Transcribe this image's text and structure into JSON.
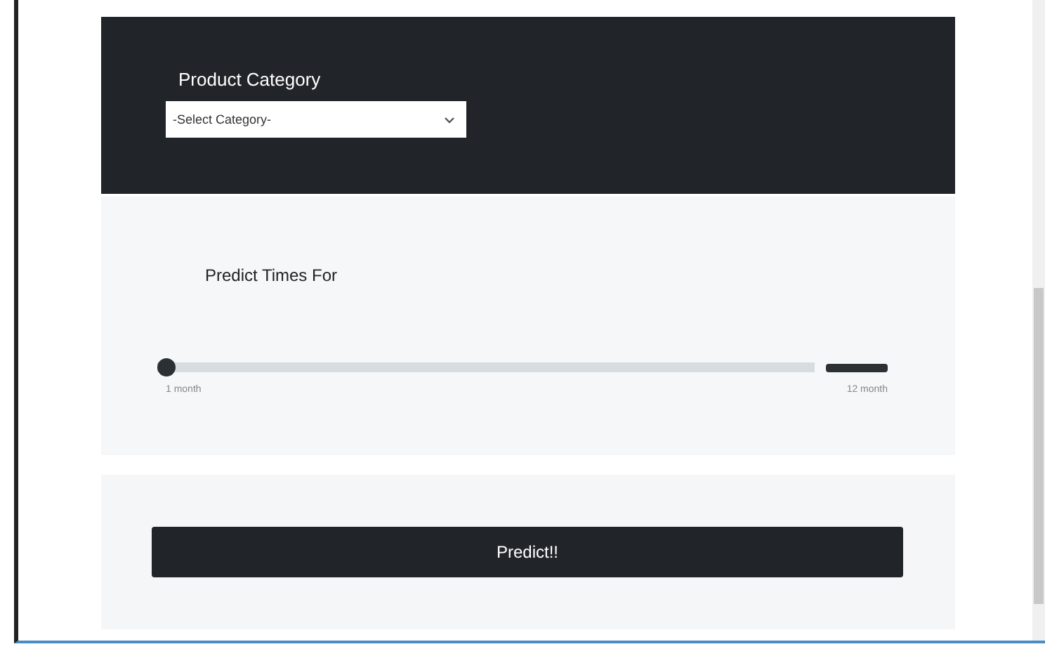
{
  "category": {
    "label": "Product Category",
    "placeholder": "-Select Category-"
  },
  "predict_range": {
    "label": "Predict Times For",
    "level": 0,
    "min_label": "1 month",
    "max_label": "12 month"
  },
  "predict_button": {
    "label": "Predict!!"
  }
}
